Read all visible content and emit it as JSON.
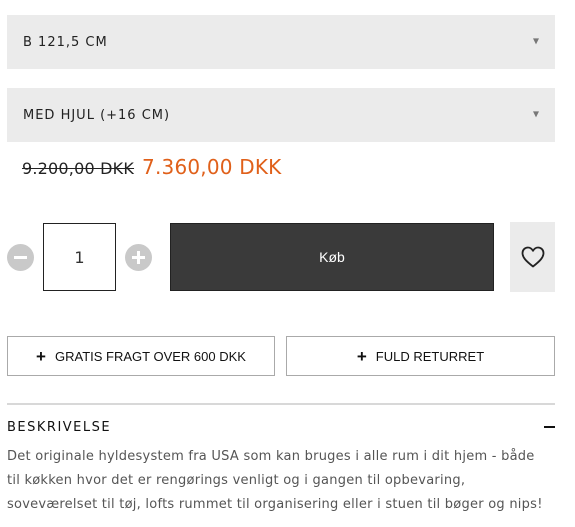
{
  "variants": {
    "size_value": "B 121,5 CM",
    "option_value": "MED HJUL (+16 CM)"
  },
  "price": {
    "original": "9.200,00 DKK",
    "sale": "7.360,00 DKK",
    "sale_color": "#e0601a"
  },
  "quantity": {
    "value": "1",
    "minus_icon": "minus-circle-icon",
    "plus_icon": "plus-circle-icon"
  },
  "buy": {
    "label": "Køb"
  },
  "wishlist": {
    "icon": "heart-icon"
  },
  "info_buttons": {
    "freight_label": "GRATIS FRAGT OVER 600 DKK",
    "return_label": "FULD RETURRET",
    "icon": "plus-icon"
  },
  "description": {
    "title": "BESKRIVELSE",
    "lines": [
      "Det originale hyldesystem fra USA som kan bruges i alle rum i dit hjem - både",
      "til køkken hvor det er rengørings venligt og i gangen til opbevaring,",
      "soveværelset til tøj, lofts rummet til organisering eller i stuen til bøger og nips!"
    ]
  }
}
